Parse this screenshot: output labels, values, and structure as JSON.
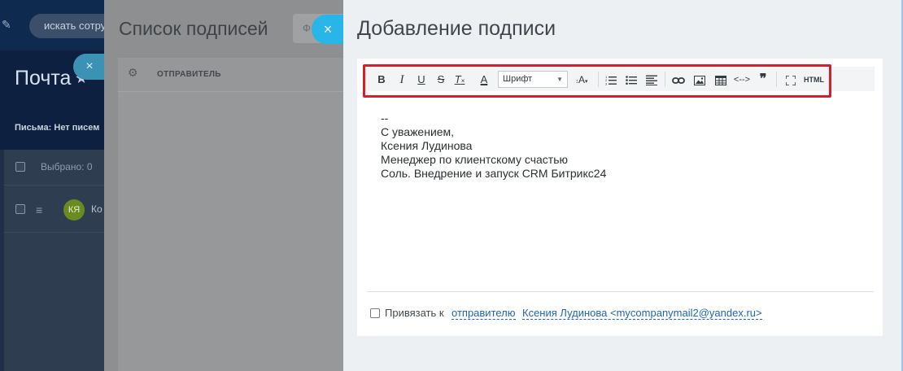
{
  "background": {
    "search_placeholder": "искать сотру",
    "title": "Почта",
    "letters_label": "Письма: Нет писем",
    "selected_label": "Выбрано: 0",
    "avatar_initials": "КЯ",
    "row_name": "Ко"
  },
  "signature_list": {
    "title": "Список подписей",
    "button_label": "Ф",
    "column_sender": "ОТПРАВИТЕЛЬ"
  },
  "close_label": "×",
  "add_signature": {
    "title": "Добавление подписи",
    "toolbar": {
      "bold": "B",
      "italic": "I",
      "underline": "U",
      "strike": "S",
      "clear_format": "T",
      "font_color": "A",
      "font_select": "Шрифт",
      "font_size": "A",
      "html": "HTML"
    },
    "signature_lines": [
      "--",
      "С уважением,",
      "Ксения Лудинова",
      "Менеджер по клиентскому счастью",
      "Соль. Внедрение и запуск CRM Битрикс24"
    ],
    "bind_label": "Привязать к",
    "bind_sender_link": "отправителю",
    "bind_sender_value": "Ксения Лудинова <mycompanymail2@yandex.ru>"
  },
  "colors": {
    "accent": "#29b5e8",
    "highlight": "#d4202a",
    "link": "#2067b0"
  }
}
